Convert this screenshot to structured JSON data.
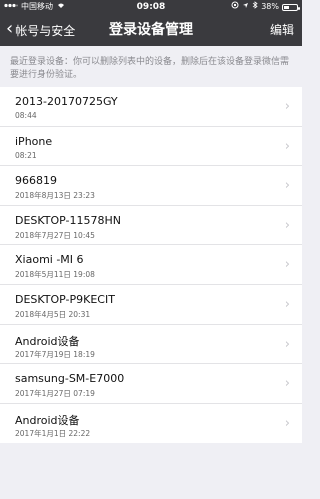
{
  "status_bar": {
    "carrier": "中国移动",
    "time": "09:08",
    "battery": "38%",
    "battery_level": 0.38
  },
  "nav": {
    "back_label": "帐号与安全",
    "title": "登录设备管理",
    "edit_label": "编辑"
  },
  "hint": "最近登录设备：你可以删除列表中的设备，删除后在该设备登录微信需要进行身份验证。",
  "devices": [
    {
      "name": "2013-20170725GY",
      "time": "08:44"
    },
    {
      "name": "iPhone",
      "time": "08:21"
    },
    {
      "name": "966819",
      "time": "2018年8月13日 23:23"
    },
    {
      "name": "DESKTOP-11578HN",
      "time": "2018年7月27日 10:45"
    },
    {
      "name": "Xiaomi -MI 6",
      "time": "2018年5月11日 19:08"
    },
    {
      "name": "DESKTOP-P9KECIT",
      "time": "2018年4月5日 20:31"
    },
    {
      "name": "Android设备",
      "time": "2017年7月19日 18:19"
    },
    {
      "name": "samsung-SM-E7000",
      "time": "2017年1月27日 07:19"
    },
    {
      "name": "Android设备",
      "time": "2017年1月1日 22:22"
    }
  ]
}
